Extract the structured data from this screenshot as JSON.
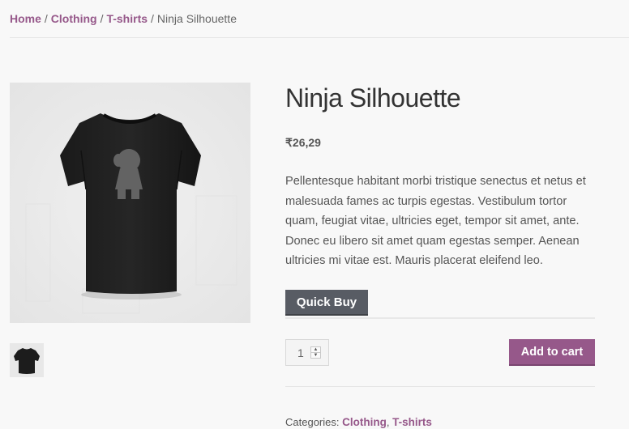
{
  "breadcrumb": {
    "items": [
      "Home",
      "Clothing",
      "T-shirts"
    ],
    "separator": "/",
    "current": "Ninja Silhouette"
  },
  "product": {
    "title": "Ninja Silhouette",
    "price": "₹26,29",
    "description": "Pellentesque habitant morbi tristique senectus et netus et malesuada fames ac turpis egestas. Vestibulum tortor quam, feugiat vitae, ultricies eget, tempor sit amet, ante. Donec eu libero sit amet quam egestas semper. Aenean ultricies mi vitae est. Mauris placerat eleifend leo.",
    "image_icon": "black-tshirt-ninja-silhouette",
    "thumbnail_icon": "black-tshirt-thumbnail"
  },
  "actions": {
    "quick_buy_label": "Quick Buy",
    "quantity": "1",
    "add_to_cart_label": "Add to cart"
  },
  "meta": {
    "categories_label": "Categories:",
    "categories": [
      "Clothing",
      "T-shirts"
    ],
    "categories_separator": ","
  },
  "colors": {
    "accent": "#96588a",
    "quick_buy_bg": "#585c64",
    "background": "#f8f8f8"
  }
}
